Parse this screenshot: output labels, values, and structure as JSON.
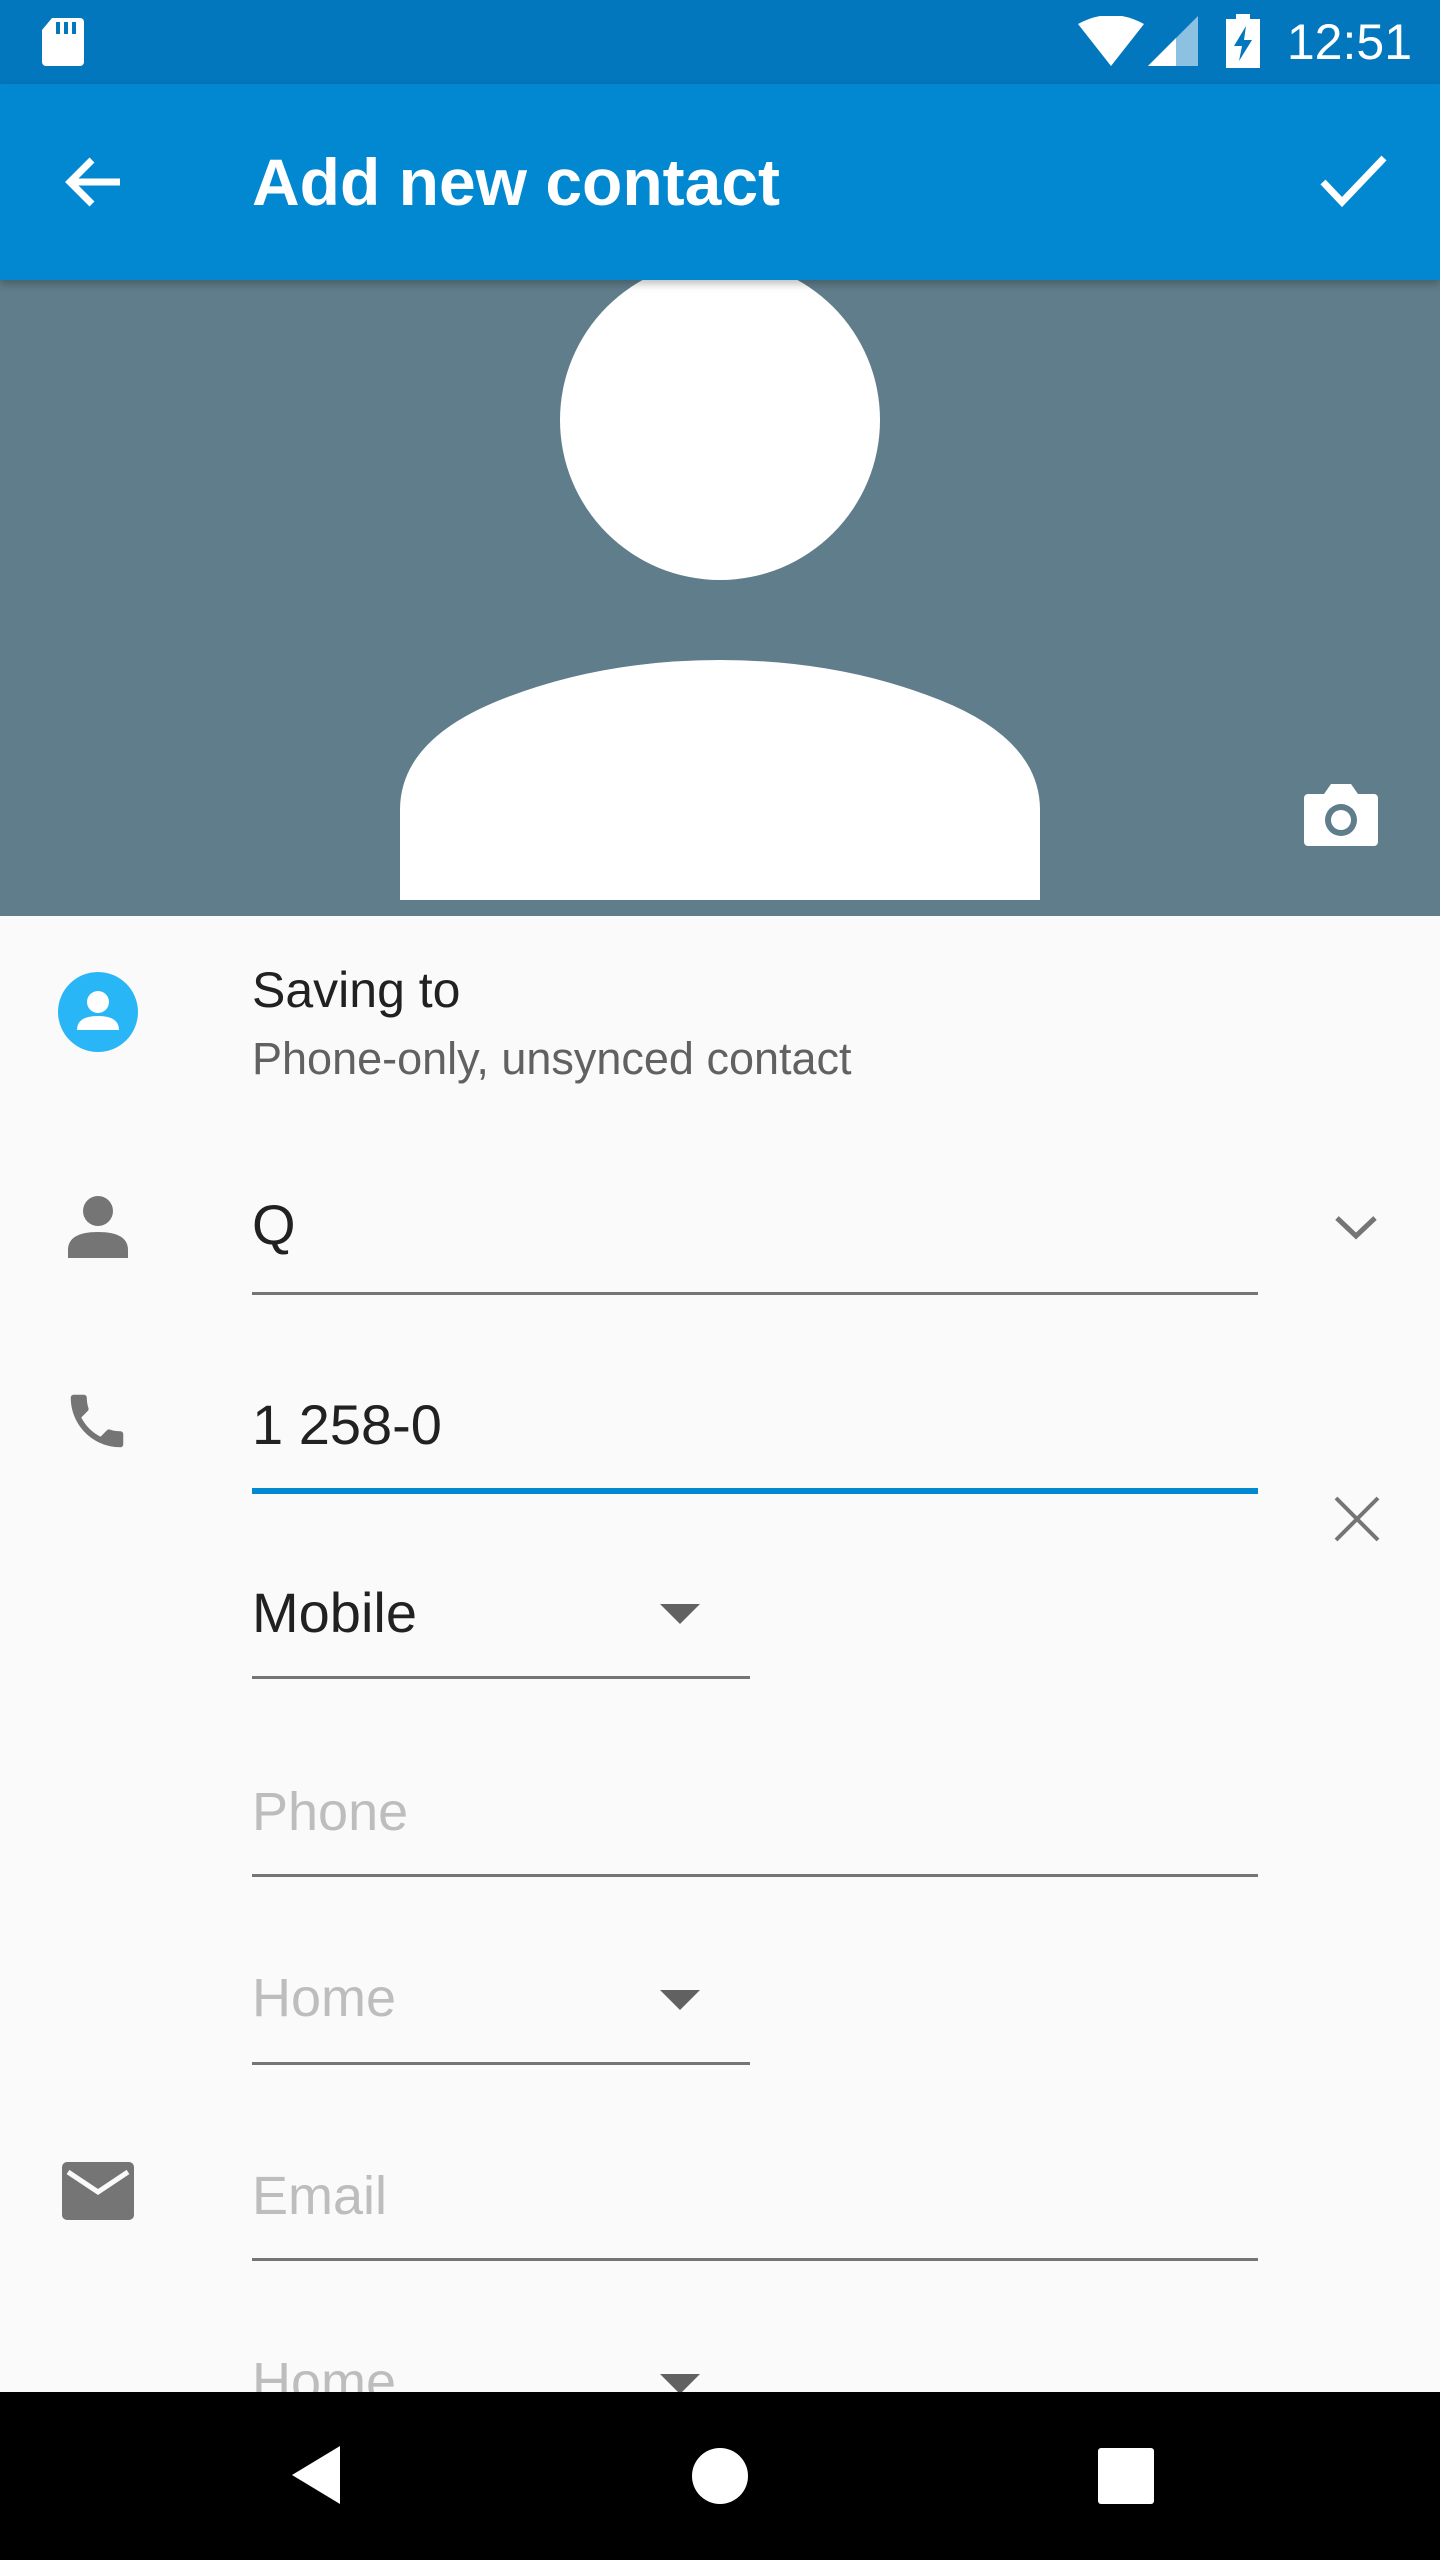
{
  "status_bar": {
    "time": "12:51"
  },
  "app_bar": {
    "title": "Add new contact"
  },
  "account": {
    "title": "Saving to",
    "subtitle": "Phone-only, unsynced contact"
  },
  "name_field": {
    "value": "Q"
  },
  "phone_field": {
    "value": "1 258-0",
    "type": "Mobile"
  },
  "phone2_field": {
    "placeholder": "Phone",
    "type": "Home"
  },
  "email_field": {
    "placeholder": "Email",
    "type": "Home"
  },
  "colors": {
    "status_bar": "#0277bd",
    "app_bar": "#0288d1",
    "photo_bg": "#607d8b",
    "accent": "#0288d1"
  }
}
